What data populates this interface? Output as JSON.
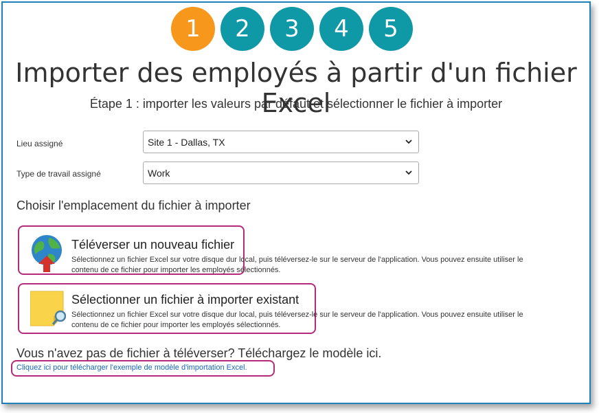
{
  "steps": [
    "1",
    "2",
    "3",
    "4",
    "5"
  ],
  "header": {
    "title": "Importer des employés à partir d'un fichier Excel",
    "subtitle": "Étape 1 : importer les valeurs par défaut et sélectionner le fichier à importer"
  },
  "form": {
    "location_label": "Lieu assigné",
    "location_value": "Site 1 - Dallas, TX",
    "work_type_label": "Type de travail assigné",
    "work_type_value": "Work"
  },
  "file_location": {
    "heading": "Choisir l'emplacement du fichier à importer",
    "options": [
      {
        "title": "Téléverser un nouveau fichier",
        "icon": "globe-upload-icon",
        "description_line1": "Sélectionnez un fichier Excel sur votre disque dur local, puis téléversez-le sur le serveur de l'application. Vous pouvez ensuite utiliser le",
        "description_line2": "contenu de ce fichier pour importer les employés sélectionnés."
      },
      {
        "title": "Sélectionner un fichier à importer existant",
        "icon": "file-search-icon",
        "description_line1": "Sélectionnez un fichier Excel sur votre disque dur local, puis téléversez-le sur le serveur de l'application. Vous pouvez ensuite utiliser le",
        "description_line2": "contenu de ce fichier pour importer les employés sélectionnés."
      }
    ]
  },
  "template": {
    "heading": "Vous n'avez pas de fichier à téléverser? Téléchargez le modèle ici.",
    "link": "Cliquez ici pour télécharger l'exemple de modèle d'importation Excel."
  },
  "colors": {
    "active_step": "#f7971c",
    "step": "#0f98a6",
    "highlight": "#b5297a",
    "link": "#1a64b8",
    "frame_border": "#1f7fb8"
  }
}
